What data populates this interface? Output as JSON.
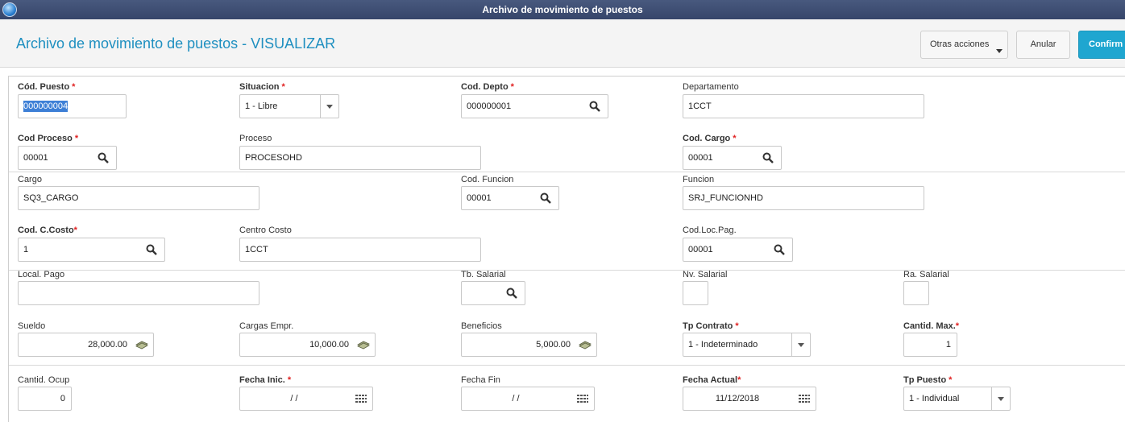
{
  "window": {
    "title": "Archivo de movimiento de puestos"
  },
  "header": {
    "title": "Archivo de movimiento de puestos - VISUALIZAR",
    "btn_more": "Otras acciones",
    "btn_cancel": "Anular",
    "btn_confirm": "Confirm"
  },
  "fields": {
    "cod_puesto": {
      "label": "Cód. Puesto",
      "value": "000000004"
    },
    "situacion": {
      "label": "Situacion",
      "value": "1 - Libre"
    },
    "cod_depto": {
      "label": "Cod. Depto",
      "value": "000000001"
    },
    "departamento": {
      "label": "Departamento",
      "value": "1CCT"
    },
    "cod_proceso": {
      "label": "Cod Proceso",
      "value": "00001"
    },
    "proceso": {
      "label": "Proceso",
      "value": "PROCESOHD"
    },
    "cod_cargo": {
      "label": "Cod. Cargo",
      "value": "00001"
    },
    "cargo": {
      "label": "Cargo",
      "value": "SQ3_CARGO"
    },
    "cod_funcion": {
      "label": "Cod. Funcion",
      "value": "00001"
    },
    "funcion": {
      "label": "Funcion",
      "value": "SRJ_FUNCIONHD"
    },
    "cod_ccosto": {
      "label": "Cod. C.Costo",
      "value": "1"
    },
    "centro_costo": {
      "label": "Centro Costo",
      "value": "1CCT"
    },
    "cod_loc_pag": {
      "label": "Cod.Loc.Pag.",
      "value": "00001"
    },
    "local_pago": {
      "label": "Local. Pago",
      "value": ""
    },
    "tb_salarial": {
      "label": "Tb. Salarial",
      "value": ""
    },
    "nv_salarial": {
      "label": "Nv. Salarial",
      "value": ""
    },
    "ra_salarial": {
      "label": "Ra. Salarial",
      "value": ""
    },
    "sueldo": {
      "label": "Sueldo",
      "value": "28,000.00"
    },
    "cargas_empr": {
      "label": "Cargas Empr.",
      "value": "10,000.00"
    },
    "beneficios": {
      "label": "Beneficios",
      "value": "5,000.00"
    },
    "tp_contrato": {
      "label": "Tp Contrato",
      "value": "1 - Indeterminado"
    },
    "cantid_max": {
      "label": "Cantid. Max.",
      "value": "1"
    },
    "cantid_ocup": {
      "label": "Cantid. Ocup",
      "value": "0"
    },
    "fecha_inic": {
      "label": "Fecha Inic.",
      "value": "/ /"
    },
    "fecha_fin": {
      "label": "Fecha Fin",
      "value": "/ /"
    },
    "fecha_actual": {
      "label": "Fecha Actual",
      "value": "11/12/2018"
    },
    "tp_puesto": {
      "label": "Tp Puesto",
      "value": "1 - Individual"
    }
  },
  "required_marker": "*",
  "colors": {
    "accent": "#1fa6d0",
    "title": "#1e8fc0",
    "required": "#e02020",
    "titlebar": "#3d4c72"
  },
  "icons": {
    "search": "search-icon",
    "money": "money-icon",
    "calendar": "calendar-icon",
    "dropdown": "chevron-down-icon"
  }
}
